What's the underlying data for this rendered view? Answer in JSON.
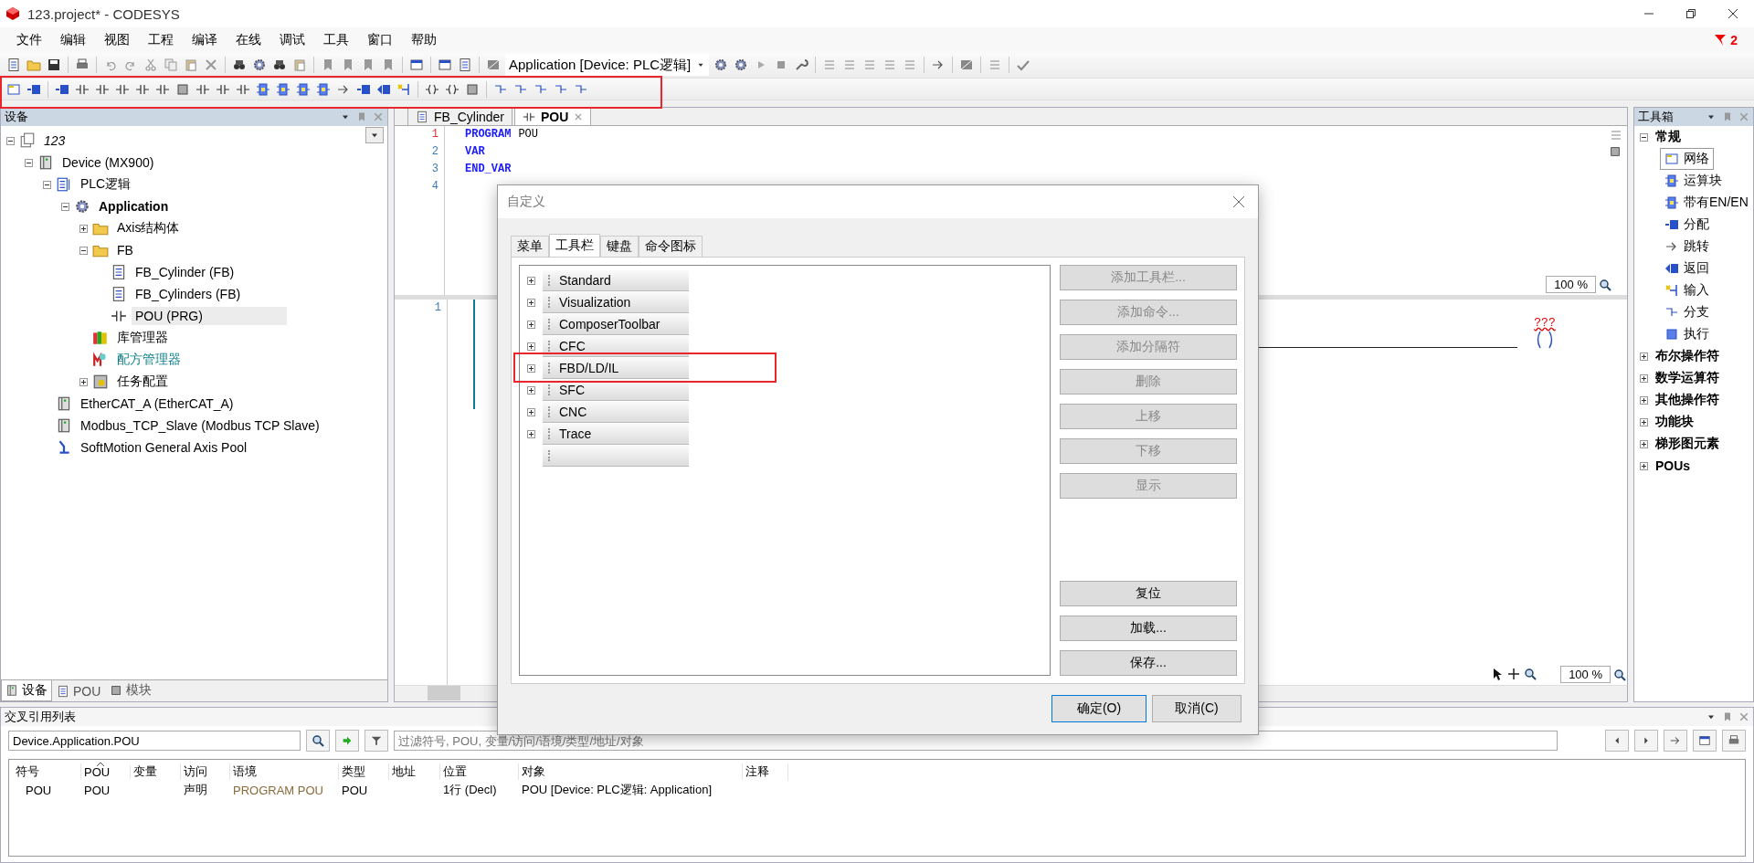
{
  "window": {
    "title": "123.project* - CODESYS"
  },
  "menu": [
    "文件",
    "编辑",
    "视图",
    "工程",
    "编译",
    "在线",
    "调试",
    "工具",
    "窗口",
    "帮助"
  ],
  "notification": {
    "count": "2"
  },
  "toolbar": {
    "application_selector": "Application [Device: PLC逻辑]"
  },
  "devices_panel": {
    "title": "设备",
    "tree": [
      {
        "label": "123",
        "kind": "project",
        "expanded": true,
        "selected": false,
        "children": [
          {
            "label": "Device (MX900)",
            "kind": "device",
            "expanded": true,
            "selected": false,
            "children": [
              {
                "label": "PLC逻辑",
                "kind": "plc",
                "expanded": true,
                "selected": false,
                "children": [
                  {
                    "label": "Application",
                    "kind": "application",
                    "expanded": true,
                    "selected": false,
                    "children": [
                      {
                        "label": "Axis结构体",
                        "kind": "folder",
                        "expanded": false,
                        "selected": false
                      },
                      {
                        "label": "FB",
                        "kind": "folder",
                        "expanded": true,
                        "selected": false,
                        "children": [
                          {
                            "label": "FB_Cylinder (FB)",
                            "kind": "fb",
                            "selected": false
                          },
                          {
                            "label": "FB_Cylinders (FB)",
                            "kind": "fb",
                            "selected": false
                          },
                          {
                            "label": "POU (PRG)",
                            "kind": "prg",
                            "selected": true
                          }
                        ]
                      },
                      {
                        "label": "库管理器",
                        "kind": "library",
                        "selected": false
                      },
                      {
                        "label": "配方管理器",
                        "kind": "recipe",
                        "selected": false
                      },
                      {
                        "label": "任务配置",
                        "kind": "task",
                        "expanded": false,
                        "selected": false
                      }
                    ]
                  }
                ]
              },
              {
                "label": "EtherCAT_A (EtherCAT_A)",
                "kind": "device",
                "selected": false
              },
              {
                "label": "Modbus_TCP_Slave (Modbus TCP Slave)",
                "kind": "device",
                "selected": false
              },
              {
                "label": "SoftMotion General Axis Pool",
                "kind": "axis",
                "selected": false
              }
            ]
          }
        ]
      }
    ],
    "tabs": [
      {
        "label": "设备",
        "selected": true
      },
      {
        "label": "POU",
        "selected": false
      },
      {
        "label": "模块",
        "selected": false
      }
    ]
  },
  "editor": {
    "tabs": [
      {
        "label": "FB_Cylinder",
        "selected": false
      },
      {
        "label": "POU",
        "selected": true
      }
    ],
    "declaration": [
      {
        "number": "1",
        "current": true,
        "keyword": "PROGRAM",
        "name": "POU"
      },
      {
        "number": "2",
        "current": false,
        "keyword": "VAR"
      },
      {
        "number": "3",
        "current": false,
        "keyword": "END_VAR"
      },
      {
        "number": "4",
        "current": false
      }
    ],
    "declaration_zoom": "100 %",
    "network": {
      "number": "1",
      "variable": "???"
    },
    "ladder_zoom": "100 %"
  },
  "toolbox": {
    "title": "工具箱",
    "groups": [
      {
        "label": "常规",
        "expanded": true,
        "items": [
          {
            "label": "网络",
            "kind": "network",
            "selected": true
          },
          {
            "label": "运算块",
            "kind": "block",
            "selected": false
          },
          {
            "label": "带有EN/EN",
            "kind": "enblock",
            "selected": false
          },
          {
            "label": "分配",
            "kind": "assign",
            "selected": false
          },
          {
            "label": "跳转",
            "kind": "jump",
            "selected": false
          },
          {
            "label": "返回",
            "kind": "return",
            "selected": false
          },
          {
            "label": "输入",
            "kind": "input",
            "selected": false
          },
          {
            "label": "分支",
            "kind": "branch",
            "selected": false
          },
          {
            "label": "执行",
            "kind": "execute",
            "selected": false
          }
        ]
      },
      {
        "label": "布尔操作符",
        "expanded": false
      },
      {
        "label": "数学运算符",
        "expanded": false
      },
      {
        "label": "其他操作符",
        "expanded": false
      },
      {
        "label": "功能块",
        "expanded": false
      },
      {
        "label": "梯形图元素",
        "expanded": false
      },
      {
        "label": "POUs",
        "expanded": false
      }
    ]
  },
  "dialog": {
    "title": "自定义",
    "tabs": [
      {
        "label": "菜单",
        "selected": false
      },
      {
        "label": "工具栏",
        "selected": true
      },
      {
        "label": "键盘",
        "selected": false
      },
      {
        "label": "命令图标",
        "selected": false
      }
    ],
    "toolbars": [
      {
        "label": "Standard",
        "expanded": false
      },
      {
        "label": "Visualization",
        "expanded": false
      },
      {
        "label": "ComposerToolbar",
        "expanded": false
      },
      {
        "label": "CFC",
        "expanded": false
      },
      {
        "label": "FBD/LD/IL",
        "expanded": false
      },
      {
        "label": "SFC",
        "expanded": false
      },
      {
        "label": "CNC",
        "expanded": false
      },
      {
        "label": "Trace",
        "expanded": false
      }
    ],
    "side_buttons": [
      {
        "label": "添加工具栏...",
        "disabled": true
      },
      {
        "label": "添加命令...",
        "disabled": true
      },
      {
        "label": "添加分隔符",
        "disabled": true
      },
      {
        "label": "删除",
        "disabled": true
      },
      {
        "label": "上移",
        "disabled": true
      },
      {
        "label": "下移",
        "disabled": true
      },
      {
        "label": "显示",
        "disabled": true
      }
    ],
    "bottom_buttons": [
      "复位",
      "加载...",
      "保存..."
    ],
    "ok": "确定(O)",
    "cancel": "取消(C)"
  },
  "cross_reference": {
    "title": "交叉引用列表",
    "object_field": "Device.Application.POU",
    "filter_placeholder": "过滤符号, POU, 变量/访问/语境/类型/地址/对象",
    "columns": [
      {
        "label": "符号",
        "sorted": false
      },
      {
        "label": "POU",
        "sorted": true
      },
      {
        "label": "变量",
        "sorted": false
      },
      {
        "label": "访问",
        "sorted": false
      },
      {
        "label": "语境",
        "sorted": false
      },
      {
        "label": "类型",
        "sorted": false
      },
      {
        "label": "地址",
        "sorted": false
      },
      {
        "label": "位置",
        "sorted": false
      },
      {
        "label": "对象",
        "sorted": false
      },
      {
        "label": "注释",
        "sorted": false
      }
    ],
    "rows": [
      {
        "cells": [
          "POU",
          "POU",
          null,
          "声明",
          "PROGRAM POU",
          "POU",
          null,
          "1行 (Decl)",
          "POU [Device: PLC逻辑: Application]",
          null
        ]
      }
    ]
  }
}
